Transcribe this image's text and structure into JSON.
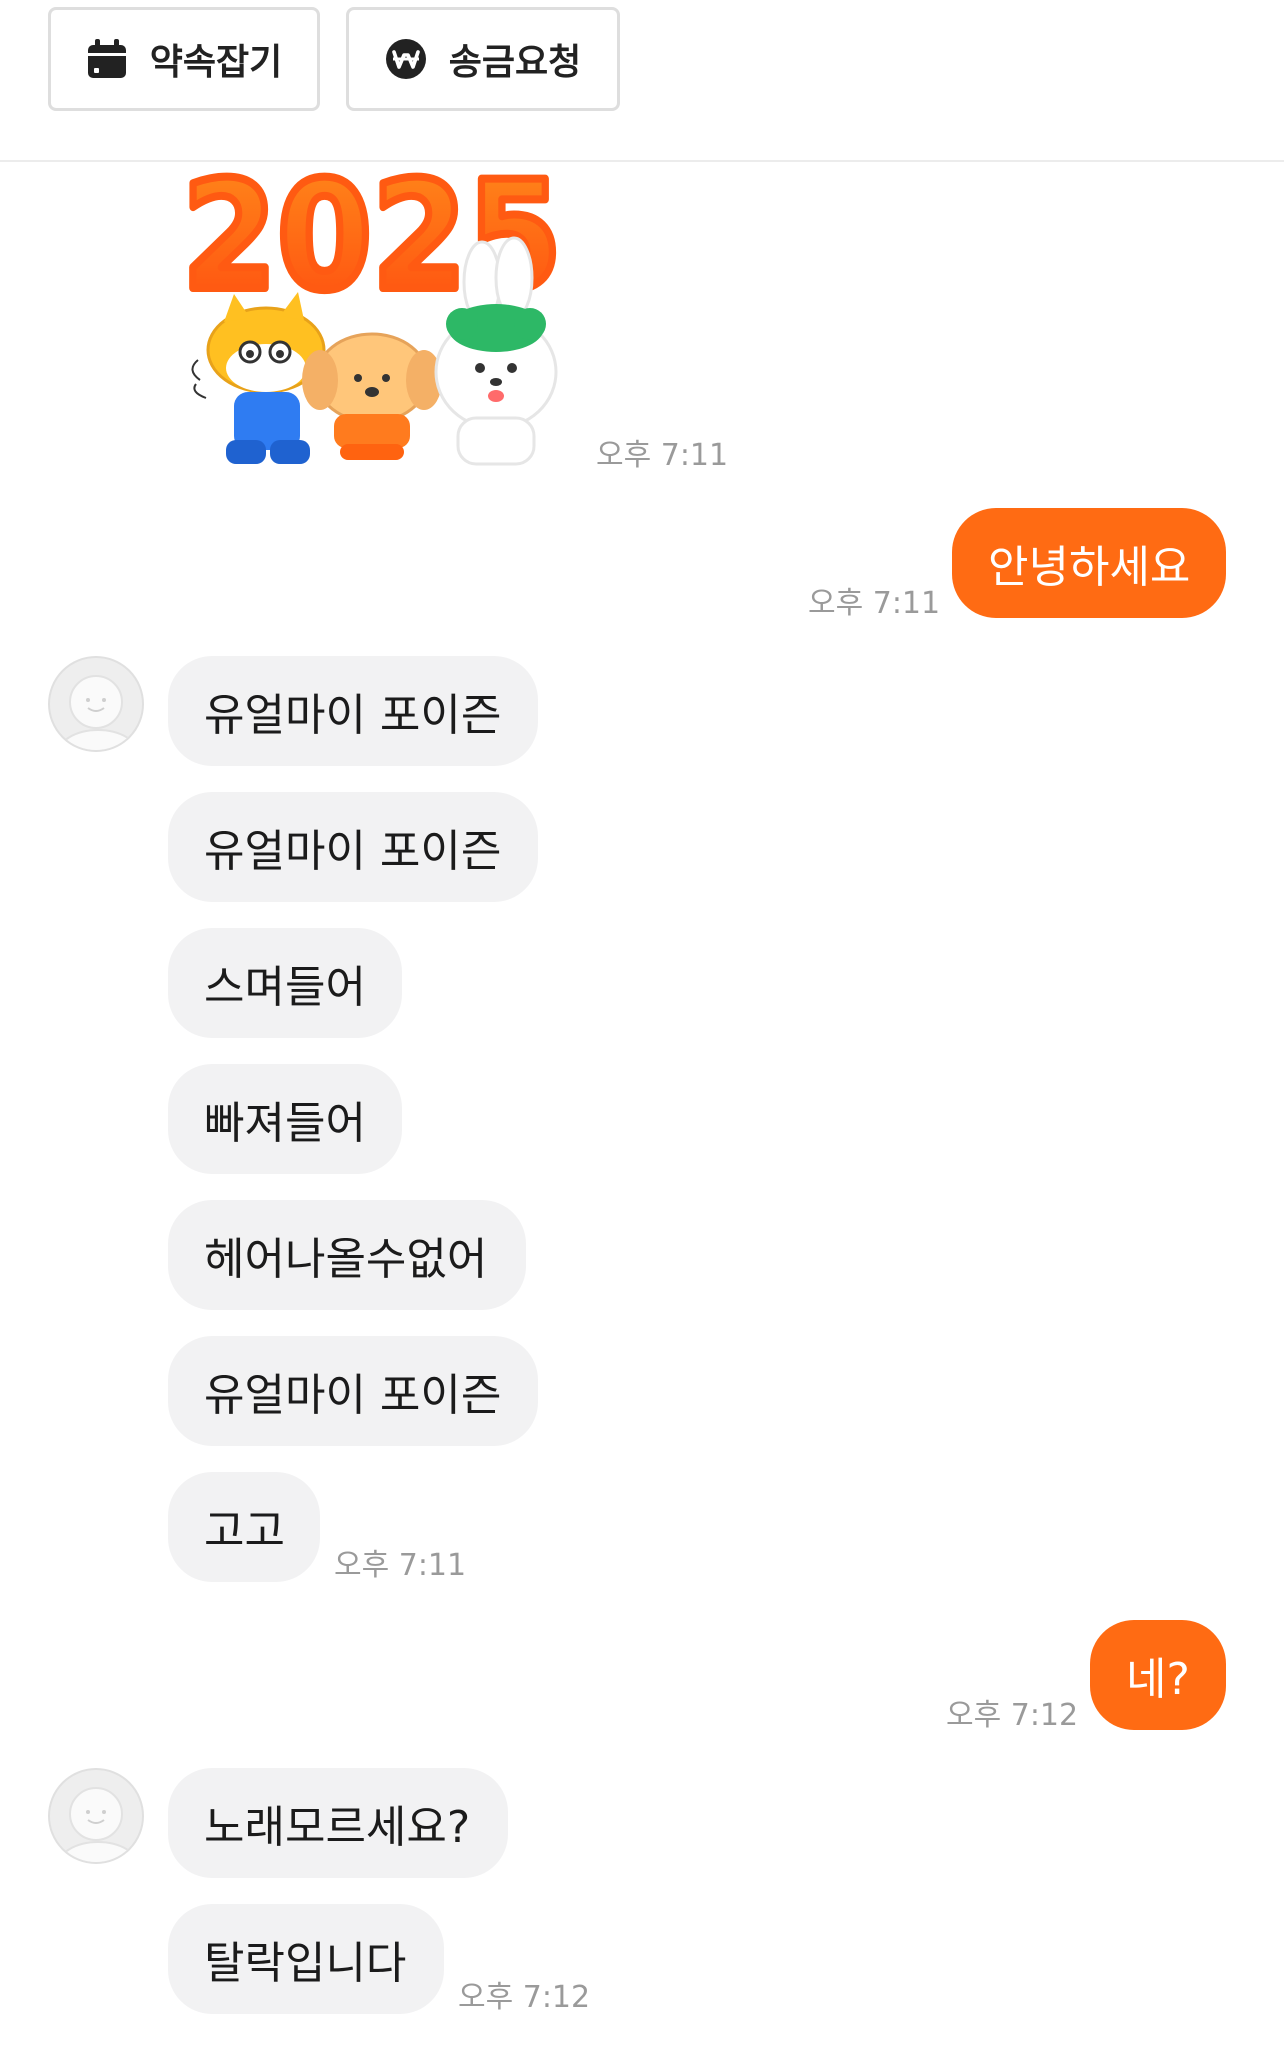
{
  "toolbar": {
    "appointment_label": "약속잡기",
    "appointment_icon": "calendar-icon",
    "remit_label": "송금요청",
    "remit_icon": "won-coin-icon"
  },
  "sticker": {
    "year_text": "2025",
    "time": "오후 7:11"
  },
  "colors": {
    "accent": "#ff6b13",
    "incoming_bubble": "#f2f2f3",
    "timestamp": "#9a9a9a"
  },
  "messages": [
    {
      "side": "out",
      "text": "안녕하세요",
      "time": "오후 7:11"
    },
    {
      "side": "in",
      "text": "유얼마이 포이즌"
    },
    {
      "side": "in",
      "text": "유얼마이 포이즌"
    },
    {
      "side": "in",
      "text": "스며들어"
    },
    {
      "side": "in",
      "text": "빠져들어"
    },
    {
      "side": "in",
      "text": "헤어나올수없어"
    },
    {
      "side": "in",
      "text": "유얼마이 포이즌"
    },
    {
      "side": "in",
      "text": "고고",
      "time": "오후 7:11"
    },
    {
      "side": "out",
      "text": "네?",
      "time": "오후 7:12"
    },
    {
      "side": "in",
      "text": "노래모르세요?"
    },
    {
      "side": "in",
      "text": "탈락입니다",
      "time": "오후 7:12"
    }
  ]
}
